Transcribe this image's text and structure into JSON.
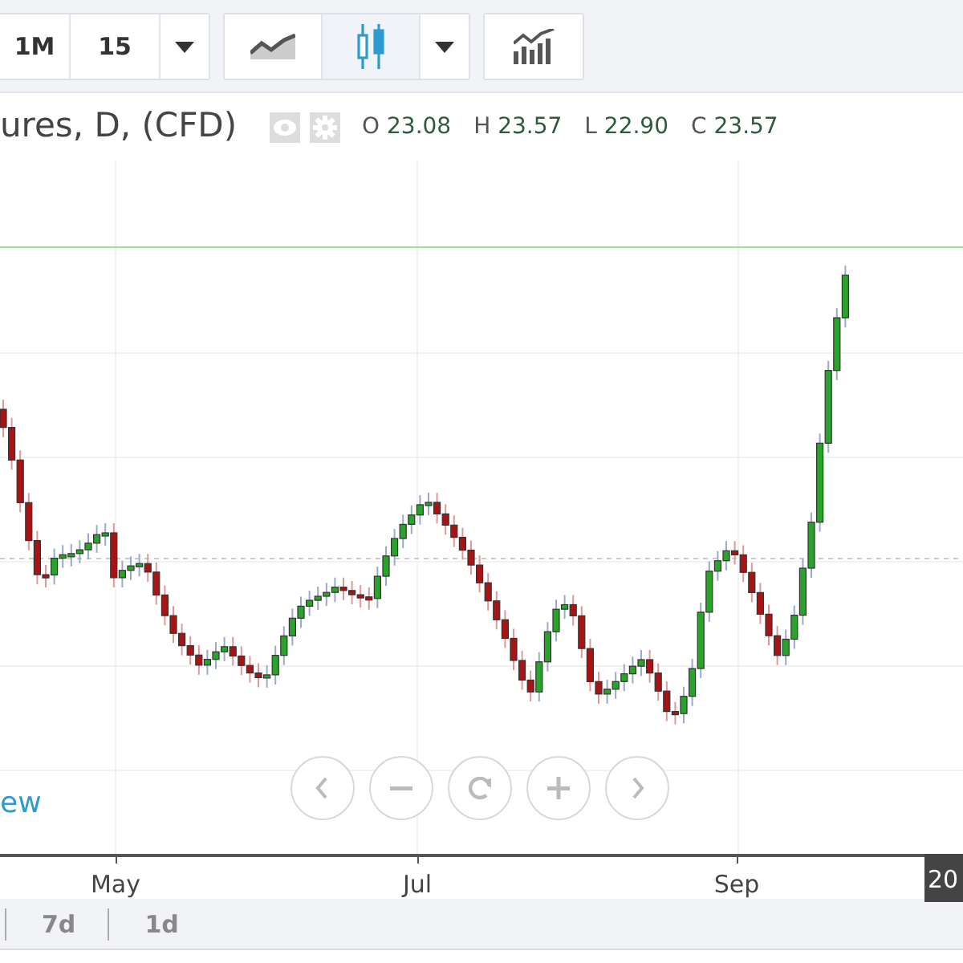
{
  "toolbar": {
    "groups": [
      [
        {
          "kind": "text",
          "label": "1M"
        },
        {
          "kind": "text",
          "label": "15"
        },
        {
          "kind": "caret"
        }
      ],
      [
        {
          "kind": "line-chart",
          "selected": false
        },
        {
          "kind": "candles",
          "selected": true
        },
        {
          "kind": "caret"
        }
      ],
      [
        {
          "kind": "indicators"
        }
      ]
    ]
  },
  "legend": {
    "title": "ures, D, (CFD)",
    "values": [
      {
        "label": "O",
        "value": "23.08"
      },
      {
        "label": "H",
        "value": "23.57"
      },
      {
        "label": "L",
        "value": "22.90"
      },
      {
        "label": "C",
        "value": "23.57"
      }
    ]
  },
  "chart": {
    "link": "ew",
    "nav_buttons": [
      {
        "kind": "prev"
      },
      {
        "kind": "zoom-out"
      },
      {
        "kind": "reset"
      },
      {
        "kind": "zoom-in"
      },
      {
        "kind": "next"
      }
    ],
    "x_axis_labels": [
      "May",
      "Jul",
      "Sep"
    ],
    "time_badge": "20"
  },
  "bottom_bar": {
    "ranges": [
      "7d",
      "1d"
    ]
  }
}
